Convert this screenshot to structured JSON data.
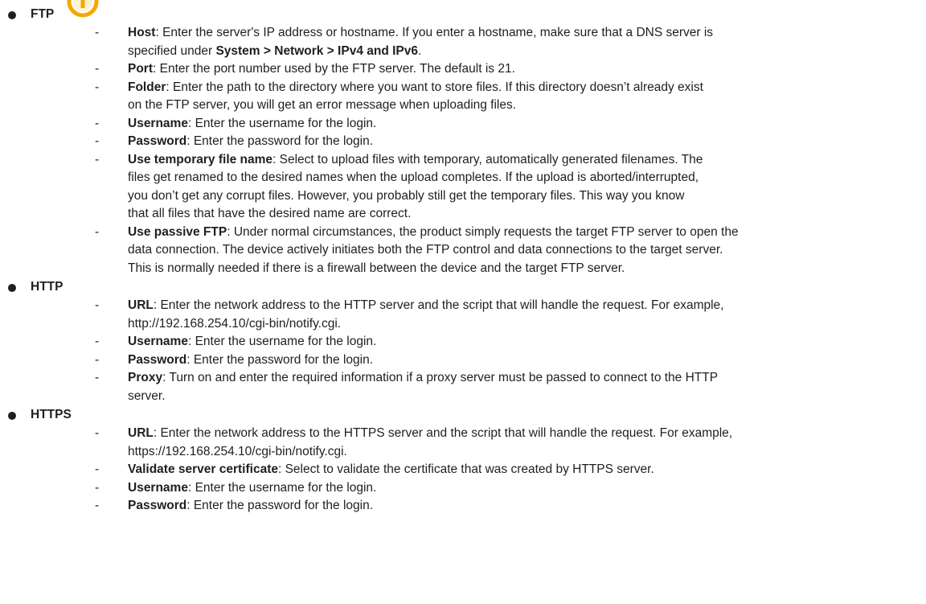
{
  "sections": [
    {
      "title": "FTP",
      "items": [
        {
          "term": "Host",
          "lines": [
            ": Enter the server's IP address or hostname. If you enter a hostname, make sure that a DNS server is",
            "specified under "
          ],
          "bold_tail": "System > Network > IPv4 and IPv6",
          "tail_end": "."
        },
        {
          "term": "Port",
          "lines": [
            ": Enter the port number used by the FTP server. The default is 21."
          ]
        },
        {
          "term": "Folder",
          "lines": [
            ": Enter the path to the directory where you want to store files. If this directory doesn’t already exist",
            "on the FTP server, you will get an error message when uploading files."
          ]
        },
        {
          "term": "Username",
          "lines": [
            ": Enter the username for the login."
          ]
        },
        {
          "term": "Password",
          "lines": [
            ": Enter the password for the login."
          ]
        },
        {
          "term": "Use temporary file name",
          "lines": [
            ": Select to upload files with temporary, automatically generated filenames. The",
            "files get renamed to the desired names when the upload completes. If the upload is aborted/interrupted,",
            "you don’t get any corrupt files. However, you probably still get the temporary files. This way you know",
            "that all files that have the desired name are correct."
          ]
        },
        {
          "term": "Use passive FTP",
          "lines": [
            ": Under normal circumstances, the product simply requests the target FTP server to open the",
            "data connection. The device actively initiates both the FTP control and data connections to the target server.",
            "This is normally needed if there is a firewall between the device and the target FTP server."
          ]
        }
      ]
    },
    {
      "title": "HTTP",
      "items": [
        {
          "term": "URL",
          "lines": [
            ": Enter the network address to the HTTP server and the script that will handle the request. For example,",
            "http://192.168.254.10/cgi-bin/notify.cgi."
          ]
        },
        {
          "term": "Username",
          "lines": [
            ": Enter the username for the login."
          ]
        },
        {
          "term": "Password",
          "lines": [
            ": Enter the password for the login."
          ]
        },
        {
          "term": "Proxy",
          "lines": [
            ": Turn on and enter the required information if a proxy server must be passed to connect to the HTTP",
            "server."
          ]
        }
      ]
    },
    {
      "title": "HTTPS",
      "items": [
        {
          "term": "URL",
          "lines": [
            ": Enter the network address to the HTTPS server and the script that will handle the request. For example,",
            "https://192.168.254.10/cgi-bin/notify.cgi."
          ]
        },
        {
          "term": "Validate server certificate",
          "lines": [
            ": Select to validate the certificate that was created by HTTPS server."
          ]
        },
        {
          "term": "Username",
          "lines": [
            ": Enter the username for the login."
          ]
        },
        {
          "term": "Password",
          "lines": [
            ": Enter the password for the login."
          ]
        }
      ]
    }
  ],
  "dash_glyph": "-",
  "note_icon": {
    "name": "important-note-icon",
    "color": "#f5a800"
  }
}
